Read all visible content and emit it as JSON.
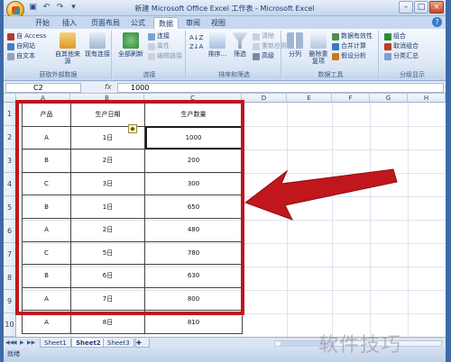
{
  "window": {
    "title": "新建 Microsoft Office Excel 工作表 - Microsoft Excel"
  },
  "tabs": [
    "开始",
    "插入",
    "页面布局",
    "公式",
    "数据",
    "审阅",
    "视图"
  ],
  "active_tab": "数据",
  "ribbon": {
    "groups": {
      "external_data": {
        "label": "获取外部数据",
        "items": [
          "自 Access",
          "自网站",
          "自文本",
          "自其他来源",
          "现有连接"
        ]
      },
      "connections": {
        "label": "连接",
        "items": [
          "全部刷新",
          "连接",
          "属性",
          "编辑链接"
        ]
      },
      "sort_filter": {
        "label": "排序和筛选",
        "items": [
          "排序...",
          "筛选",
          "清除",
          "重新应用",
          "高级"
        ]
      },
      "data_tools": {
        "label": "数据工具",
        "items": [
          "分列",
          "删除重复项",
          "数据有效性",
          "合并计算",
          "假设分析"
        ]
      },
      "outline": {
        "label": "分级显示",
        "items": [
          "组合",
          "取消组合",
          "分类汇总"
        ]
      }
    }
  },
  "formula_bar": {
    "name_box": "C2",
    "fx": "fx",
    "value": "1000"
  },
  "columns": [
    "A",
    "B",
    "C",
    "D",
    "E",
    "F",
    "G",
    "H"
  ],
  "rows": [
    "1",
    "2",
    "3",
    "4",
    "5",
    "6",
    "7",
    "8",
    "9",
    "10"
  ],
  "table": {
    "headers": [
      "产品",
      "生产日期",
      "生产数量"
    ],
    "rows": [
      [
        "A",
        "1日",
        "1000"
      ],
      [
        "B",
        "2日",
        "200"
      ],
      [
        "C",
        "3日",
        "300"
      ],
      [
        "B",
        "1日",
        "650"
      ],
      [
        "A",
        "2日",
        "480"
      ],
      [
        "C",
        "5日",
        "780"
      ],
      [
        "B",
        "6日",
        "630"
      ],
      [
        "A",
        "7日",
        "800"
      ],
      [
        "A",
        "8日",
        "810"
      ]
    ]
  },
  "sheet_tabs": [
    "Sheet1",
    "Sheet2",
    "Sheet3"
  ],
  "active_sheet": "Sheet2",
  "status": "就绪",
  "watermark": "软件技巧",
  "colors": {
    "annotation_red": "#c0161c",
    "ribbon_blue": "#dce7f5"
  }
}
